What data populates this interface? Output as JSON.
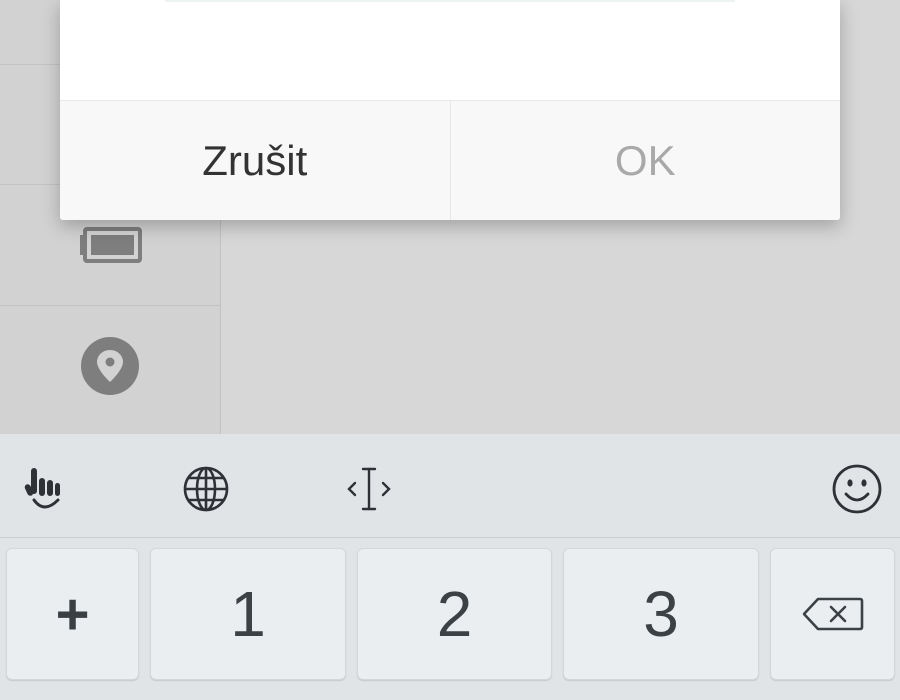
{
  "dialog": {
    "cancel_label": "Zrušit",
    "ok_label": "OK"
  },
  "keyboard": {
    "toolbar_icons": [
      "hand-gesture-icon",
      "globe-icon",
      "text-cursor-icon",
      "smiley-icon"
    ],
    "keys": [
      {
        "name": "plus-key",
        "label": "+"
      },
      {
        "name": "key-1",
        "label": "1"
      },
      {
        "name": "key-2",
        "label": "2"
      },
      {
        "name": "key-3",
        "label": "3"
      },
      {
        "name": "backspace-key",
        "icon": "backspace-icon"
      }
    ]
  },
  "colors": {
    "dialog_bg": "#ffffff",
    "ok_disabled": "#a9a9a9",
    "keyboard_bg": "#e1e4e6"
  }
}
